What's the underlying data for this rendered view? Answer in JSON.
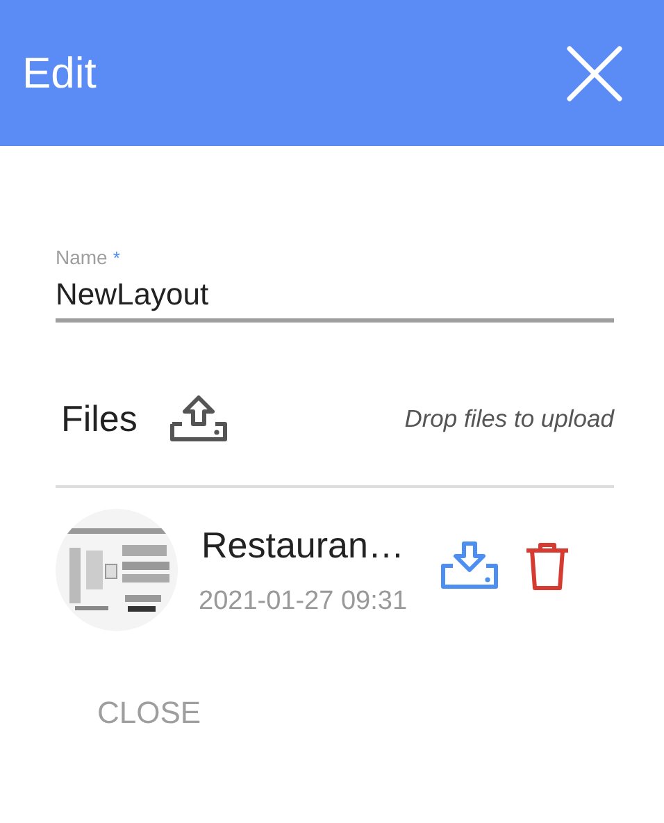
{
  "window": {
    "title": "Edit"
  },
  "name_field": {
    "label": "Name",
    "required_mark": "*",
    "value": "NewLayout"
  },
  "files": {
    "heading": "Files",
    "hint": "Drop files to upload",
    "items": [
      {
        "kind": "picture",
        "name": "Restauran…",
        "date": "2021-01-27 09:31"
      }
    ]
  },
  "buttons": [
    "CLOSE"
  ]
}
